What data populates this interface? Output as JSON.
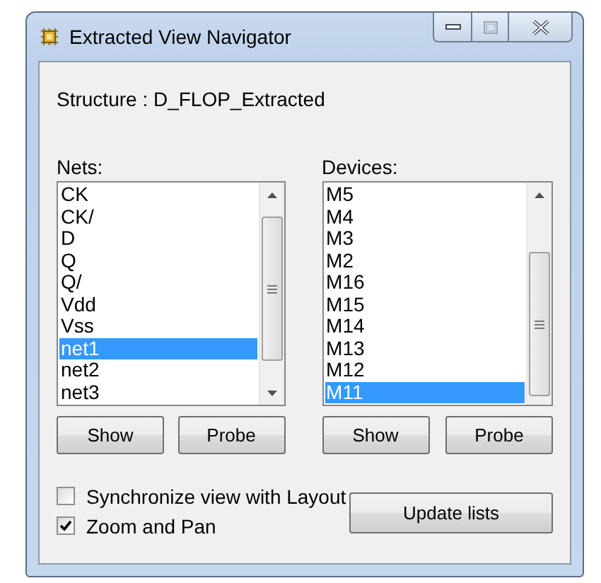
{
  "window": {
    "title": "Extracted View Navigator"
  },
  "structure": "Structure : D_FLOP_Extracted",
  "panels": [
    {
      "label": "Nets:",
      "items": [
        {
          "text": "CK",
          "selected": false
        },
        {
          "text": "CK/",
          "selected": false
        },
        {
          "text": "D",
          "selected": false
        },
        {
          "text": "Q",
          "selected": false
        },
        {
          "text": "Q/",
          "selected": false
        },
        {
          "text": "Vdd",
          "selected": false
        },
        {
          "text": "Vss",
          "selected": false
        },
        {
          "text": "net1",
          "selected": true
        },
        {
          "text": "net2",
          "selected": false
        },
        {
          "text": "net3",
          "selected": false
        }
      ],
      "buttons": [
        "Show",
        "Probe"
      ]
    },
    {
      "label": "Devices:",
      "items": [
        {
          "text": "M5",
          "selected": false
        },
        {
          "text": "M4",
          "selected": false
        },
        {
          "text": "M3",
          "selected": false
        },
        {
          "text": "M2",
          "selected": false
        },
        {
          "text": "M16",
          "selected": false
        },
        {
          "text": "M15",
          "selected": false
        },
        {
          "text": "M14",
          "selected": false
        },
        {
          "text": "M13",
          "selected": false
        },
        {
          "text": "M12",
          "selected": false
        },
        {
          "text": "M11",
          "selected": true
        }
      ],
      "buttons": [
        "Show",
        "Probe"
      ]
    }
  ],
  "options": [
    {
      "label": "Synchronize view with Layout",
      "checked": false
    },
    {
      "label": "Zoom and Pan",
      "checked": true
    }
  ],
  "update_button": "Update lists"
}
